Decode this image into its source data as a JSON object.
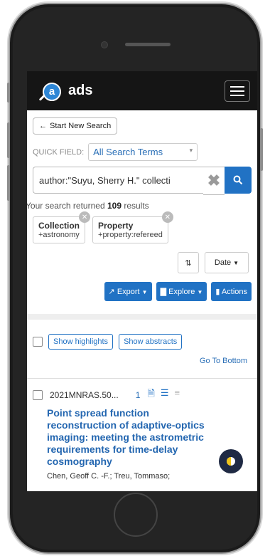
{
  "app": {
    "brand": "ads"
  },
  "start_search": {
    "label": "Start New Search"
  },
  "quick_field": {
    "label": "QUICK FIELD:",
    "selected": "All Search Terms"
  },
  "search": {
    "value": "author:\"Suyu, Sherry H.\" collecti"
  },
  "results": {
    "prefix": "Your search returned ",
    "count": "109",
    "suffix": " results"
  },
  "filters": [
    {
      "title": "Collection",
      "value": "+astronomy"
    },
    {
      "title": "Property",
      "value": "+property:refereed"
    }
  ],
  "sort": {
    "field": "Date"
  },
  "actions": {
    "export": "Export",
    "explore": "Explore",
    "actions": "Actions"
  },
  "list_controls": {
    "show_highlights": "Show highlights",
    "show_abstracts": "Show abstracts",
    "go_to_bottom": "Go To Bottom"
  },
  "record": {
    "bibcode": "2021MNRAS.50...",
    "number": "1",
    "title": "Point spread function reconstruction of adaptive-optics imaging: meeting the astrometric requirements for time-delay cosmography",
    "authors": "Chen, Geoff C. -F.;  Treu, Tommaso;"
  },
  "colors": {
    "accent": "#2172c4",
    "nav_bg": "#151515"
  }
}
